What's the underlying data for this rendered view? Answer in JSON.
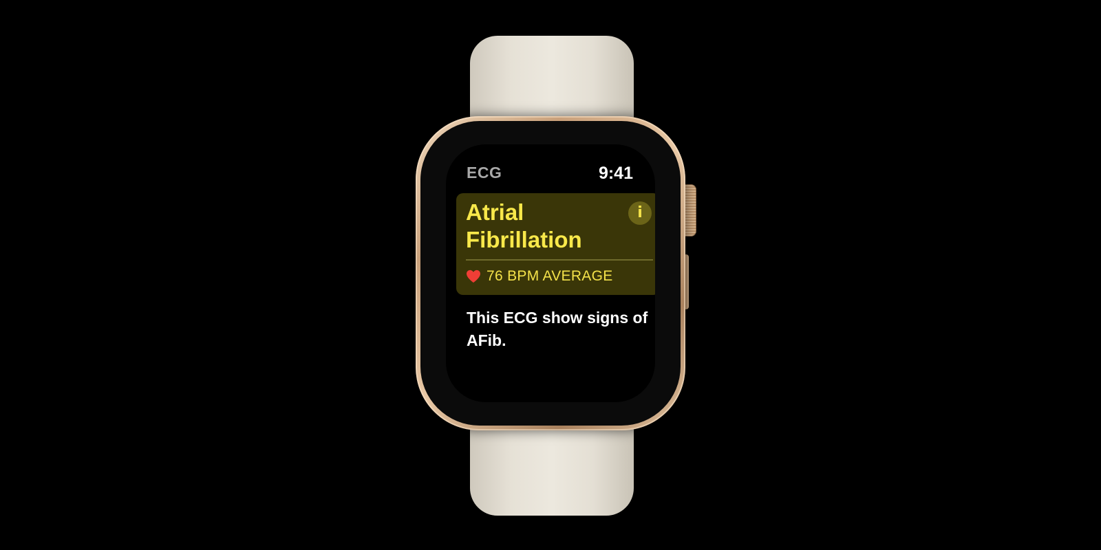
{
  "watch": {
    "app_title": "ECG",
    "time": "9:41"
  },
  "result": {
    "title": "Atrial Fibrillation",
    "info_icon": "i",
    "bpm_label": "76 BPM AVERAGE"
  },
  "description": "This ECG show signs of AFib.",
  "icons": {
    "heart": "heart-icon",
    "info": "info-icon"
  },
  "colors": {
    "accent_yellow": "#f8e84a",
    "card_background": "#3a3608",
    "heart_red": "#ef3e36",
    "background": "#000000"
  }
}
